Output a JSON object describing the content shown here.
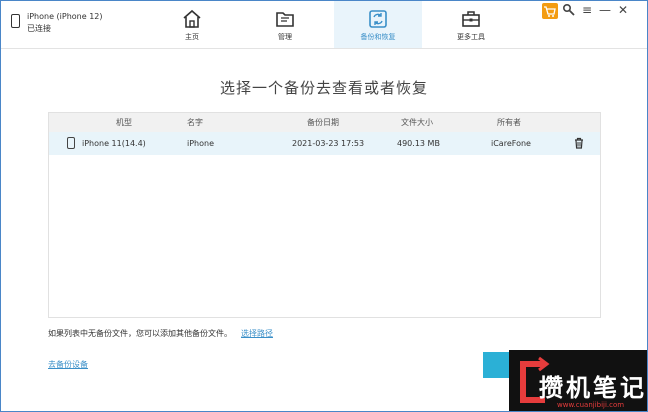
{
  "device": {
    "name": "iPhone (iPhone 12)",
    "status": "已连接"
  },
  "tabs": [
    {
      "label": "主页",
      "icon": "home-icon"
    },
    {
      "label": "管理",
      "icon": "folder-icon"
    },
    {
      "label": "备份和恢复",
      "icon": "backup-restore-icon",
      "active": true
    },
    {
      "label": "更多工具",
      "icon": "toolbox-icon"
    }
  ],
  "window_controls": [
    "cart-icon",
    "search-key-icon",
    "menu-icon",
    "minimize-icon",
    "close-icon"
  ],
  "heading": "选择一个备份去查看或者恢复",
  "table": {
    "columns": [
      "机型",
      "名字",
      "备份日期",
      "文件大小",
      "所有者"
    ],
    "rows": [
      {
        "model": "iPhone 11(14.4)",
        "name": "iPhone",
        "date": "2021-03-23 17:53",
        "size": "490.13 MB",
        "owner": "iCareFone",
        "selected": true
      }
    ]
  },
  "hint": {
    "text": "如果列表中无备份文件，您可以添加其他备份文件。",
    "link": "选择路径"
  },
  "bottom_link": "去备份设备",
  "watermark": {
    "title": "攒机笔记",
    "url": "www.cuanjibiji.com"
  },
  "colors": {
    "accent": "#3a8fc8",
    "active_tab_bg": "#e9f4fb",
    "selected_row": "#e8f4fa",
    "button": "#2bb0d6",
    "cart": "#f39c12"
  }
}
